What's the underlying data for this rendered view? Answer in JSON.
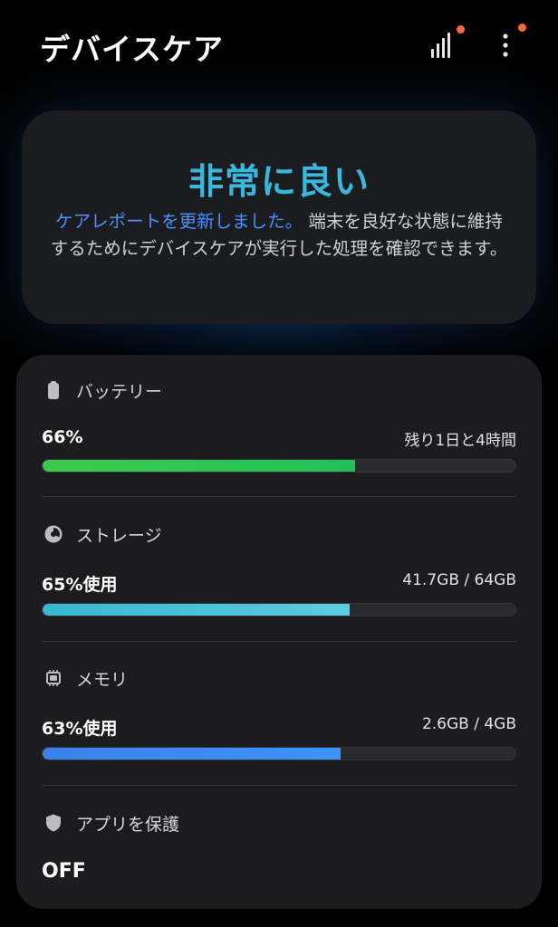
{
  "header": {
    "title": "デバイスケア",
    "signal_icon": "signal-bars-icon",
    "more_icon": "more-vertical-icon",
    "notification_color": "#f26b3a"
  },
  "status": {
    "title": "非常に良い",
    "title_color": "#3ab8dc",
    "link_text": "ケアレポートを更新しました。",
    "link_color": "#4a90ff",
    "description": "端末を良好な状態に維持するためにデバイスケアが実行した処理を確認できます。"
  },
  "battery": {
    "label": "バッテリー",
    "icon": "battery-icon",
    "value": "66%",
    "detail": "残り1日と4時間",
    "level": 0.66,
    "color_start": "#3fc94c",
    "color_end": "#22c05a"
  },
  "storage": {
    "label": "ストレージ",
    "icon": "pie-chart-icon",
    "value": "65%使用",
    "detail": "41.7GB / 64GB",
    "level": 0.65,
    "color_start": "#36b8cf",
    "color_end": "#5ccbe0"
  },
  "memory": {
    "label": "メモリ",
    "icon": "memory-chip-icon",
    "value": "63%使用",
    "detail": "2.6GB / 4GB",
    "level": 0.63,
    "color_start": "#3a82ea",
    "color_end": "#3d93ff"
  },
  "app_protection": {
    "label": "アプリを保護",
    "icon": "shield-icon",
    "value": "OFF"
  }
}
